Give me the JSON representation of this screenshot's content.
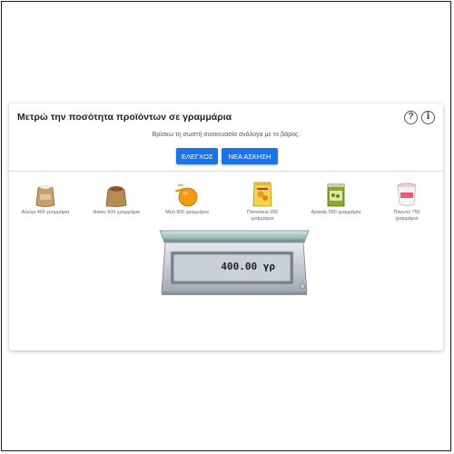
{
  "header": {
    "title": "Μετρώ την ποσότητα προϊόντων σε γραμμάρια",
    "help_icon": "question-circle-icon",
    "info_icon": "info-circle-icon"
  },
  "instructions": "Βρίσκω τη σωστή συσκευασία ανάλογα με το βάρος.",
  "buttons": {
    "check_label": "ΕΛΕΓΧΟΣ",
    "new_exercise_label": "ΝΕΑ ΑΣΚΗΣΗ"
  },
  "products": [
    {
      "label_lines": [
        "Αλεύρι 400 γραμμάρια"
      ],
      "icon": "flour-sack-icon"
    },
    {
      "label_lines": [
        "Φακές 600 γραμμάρια"
      ],
      "icon": "lentils-sack-icon"
    },
    {
      "label_lines": [
        "Μέλι 900 γραμμάρια"
      ],
      "icon": "honey-jar-icon"
    },
    {
      "label_lines": [
        "Πατατάκια 350",
        "γραμμάρια"
      ],
      "icon": "chips-bag-icon"
    },
    {
      "label_lines": [
        "Αρακάς 550 γραμμάρια"
      ],
      "icon": "peas-can-icon"
    },
    {
      "label_lines": [
        "Παγωτό 750",
        "γραμμάρια"
      ],
      "icon": "ice-cream-tub-icon"
    }
  ],
  "scale": {
    "reading": "400.00 γρ",
    "icon": "kitchen-scale-icon"
  },
  "colors": {
    "accent": "#1a73e8"
  }
}
